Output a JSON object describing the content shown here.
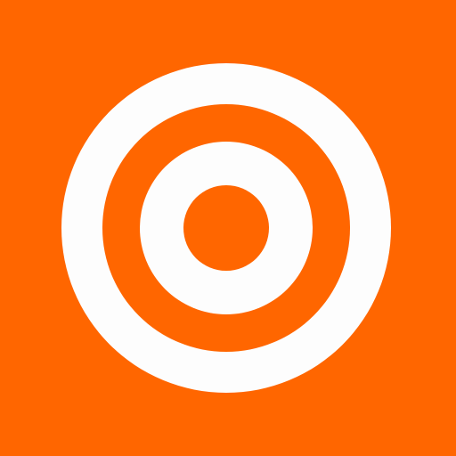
{
  "icon": {
    "name": "target-rings-icon",
    "colors": {
      "background": "#ff6600",
      "rings": "#fdfdfd"
    }
  }
}
